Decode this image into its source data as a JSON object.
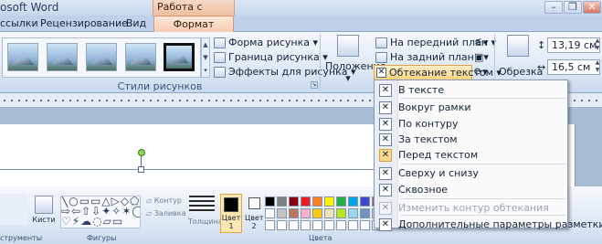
{
  "window": {
    "app_title": "osoft Word",
    "context_tab_title": "Работа с рисунками"
  },
  "tabs": [
    "ссылки",
    "Рецензирование",
    "Вид",
    "Формат"
  ],
  "ribbon": {
    "picture_shape": "Форма рисунка",
    "picture_border": "Граница рисунка",
    "picture_effects": "Эффекты для рисунка",
    "styles_group_label": "Стили рисунков",
    "position": "Положение",
    "bring_front": "На передний план",
    "send_back": "На задний план",
    "wrap_text": "Обтекание текстом",
    "crop": "Обрезка",
    "height": "13,19 см",
    "width": "16,5 см"
  },
  "wrap_menu": {
    "items": [
      "В тексте",
      "Вокруг рамки",
      "По контуру",
      "За текстом",
      "Перед текстом",
      "Сверху и снизу",
      "Сквозное",
      "Изменить контур обтекания",
      "Дополнительные параметры разметки..."
    ],
    "active_index": 4,
    "disabled_index": 7
  },
  "lower_ribbon": {
    "brushes": "Кисти",
    "outline": "Контур",
    "fill": "Заливка",
    "thickness": "Толщина",
    "color1": "Цвет 1",
    "color2": "Цвет 2",
    "tools_label": "струменты",
    "shapes_label": "Фигуры",
    "colors_label": "Цвета",
    "colors": [
      "#000000",
      "#7f7f7f",
      "#880015",
      "#ed1c24",
      "#ff7f27",
      "#fff200",
      "#22b14c",
      "#00a2e8",
      "#3f48cc",
      "#a349a4",
      "#ffffff",
      "#c3c3c3",
      "#b97a57",
      "#ffaec9",
      "#ffc90e",
      "#efe4b0",
      "#b5e61d",
      "#99d9ea",
      "#7092be",
      "#c8bfe7"
    ]
  }
}
